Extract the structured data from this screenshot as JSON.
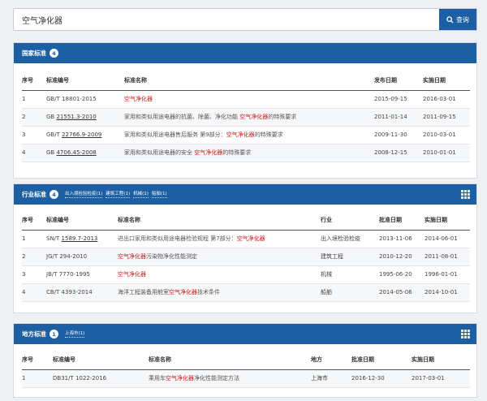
{
  "search": {
    "query": "空气净化器",
    "button_label": "查询"
  },
  "national": {
    "title": "国家标准",
    "count": "4",
    "columns": [
      "序号",
      "标准编号",
      "标准名称",
      "发布日期",
      "实施日期"
    ],
    "rows": [
      {
        "no": "1",
        "code_prefix": "GB/T 18801-2015",
        "code_link": "",
        "name_pre": "",
        "name_hl": "空气净化器",
        "name_post": "",
        "pub": "2015-09-15",
        "impl": "2016-03-01"
      },
      {
        "no": "2",
        "code_prefix": "GB ",
        "code_link": "21551.3-2010",
        "name_pre": "家用和类似用途电器的抗菌、除菌、净化功能 ",
        "name_hl": "空气净化器",
        "name_post": "的特殊要求",
        "pub": "2011-01-14",
        "impl": "2011-09-15"
      },
      {
        "no": "3",
        "code_prefix": "GB/T ",
        "code_link": "22766.9-2009",
        "name_pre": "家用和类似用途电器售后服务 第9部分：",
        "name_hl": "空气净化器",
        "name_post": "的特殊要求",
        "pub": "2009-11-30",
        "impl": "2010-03-01"
      },
      {
        "no": "4",
        "code_prefix": "GB ",
        "code_link": "4706.45-2008",
        "name_pre": "家用和类似用途电器的安全 ",
        "name_hl": "空气净化器",
        "name_post": "的特殊要求",
        "pub": "2008-12-15",
        "impl": "2010-01-01"
      }
    ]
  },
  "industry": {
    "title": "行业标准",
    "count": "4",
    "tags": [
      "出入境检验检疫(1)",
      "建筑工程(1)",
      "机械(1)",
      "船舶(1)"
    ],
    "columns": [
      "序号",
      "标准编号",
      "标准名称",
      "行业",
      "批准日期",
      "实施日期"
    ],
    "rows": [
      {
        "no": "1",
        "code_prefix": "SN/T ",
        "code_link": "1589.7-2013",
        "name_pre": "进出口家用和类似用途电器检验规程 第7部分：",
        "name_hl": "空气净化器",
        "name_post": "",
        "industry": "出入境检验检疫",
        "appr": "2013-11-06",
        "impl": "2014-06-01"
      },
      {
        "no": "2",
        "code_prefix": "JG/T 294-2010",
        "code_link": "",
        "name_pre": "",
        "name_hl": "空气净化器",
        "name_post": "污染物净化性能测定",
        "industry": "建筑工程",
        "appr": "2010-12-20",
        "impl": "2011-08-01"
      },
      {
        "no": "3",
        "code_prefix": "JB/T 7770-1995",
        "code_link": "",
        "name_pre": "",
        "name_hl": "空气净化器",
        "name_post": "",
        "industry": "机械",
        "appr": "1995-06-20",
        "impl": "1996-01-01"
      },
      {
        "no": "4",
        "code_prefix": "CB/T 4393-2014",
        "code_link": "",
        "name_pre": "海洋工程装备用舱室",
        "name_hl": "空气净化器",
        "name_post": "技术条件",
        "industry": "船舶",
        "appr": "2014-05-06",
        "impl": "2014-10-01"
      }
    ]
  },
  "local": {
    "title": "地方标准",
    "count": "1",
    "tags": [
      "上海市(1)"
    ],
    "columns": [
      "序号",
      "标准编号",
      "标准名称",
      "地方",
      "批准日期",
      "实施日期"
    ],
    "rows": [
      {
        "no": "1",
        "code_prefix": "DB31/T 1022-2016",
        "code_link": "",
        "name_pre": "乘用车",
        "name_hl": "空气净化器",
        "name_post": "净化性能测定方法",
        "region": "上海市",
        "appr": "2016-12-30",
        "impl": "2017-03-01"
      }
    ]
  }
}
